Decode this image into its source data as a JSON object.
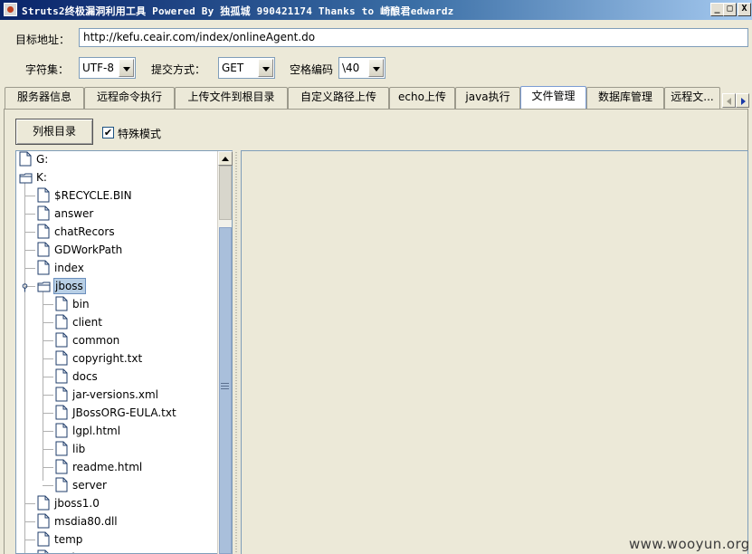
{
  "window": {
    "title": "Struts2终极漏洞利用工具    Powered By 独孤城 990421174 Thanks to 崎酿君edwardz",
    "controls": {
      "minimize": "_",
      "maximize": "□",
      "close": "X"
    }
  },
  "form": {
    "url_label": "目标地址：",
    "url_value": "http://kefu.ceair.com/index/onlineAgent.do",
    "charset_label": "字符集：",
    "charset_value": "UTF-8",
    "method_label": "提交方式：",
    "method_value": "GET",
    "space_label": "空格编码",
    "space_value": "\\40"
  },
  "tabs": [
    {
      "label": "服务器信息",
      "active": false
    },
    {
      "label": "远程命令执行",
      "active": false
    },
    {
      "label": "上传文件到根目录",
      "active": false
    },
    {
      "label": "自定义路径上传",
      "active": false
    },
    {
      "label": "echo上传",
      "active": false
    },
    {
      "label": "java执行",
      "active": false
    },
    {
      "label": "文件管理",
      "active": true
    },
    {
      "label": "数据库管理",
      "active": false
    },
    {
      "label": "远程文...",
      "active": false
    }
  ],
  "file_manager": {
    "list_root_button": "列根目录",
    "special_mode_label": "特殊模式",
    "special_mode_checked": true,
    "tree": [
      {
        "name": "G:",
        "depth": 0,
        "type": "file"
      },
      {
        "name": "K:",
        "depth": 0,
        "type": "folder"
      },
      {
        "name": "$RECYCLE.BIN",
        "depth": 1,
        "type": "file"
      },
      {
        "name": "answer",
        "depth": 1,
        "type": "file"
      },
      {
        "name": "chatRecors",
        "depth": 1,
        "type": "file"
      },
      {
        "name": "GDWorkPath",
        "depth": 1,
        "type": "file"
      },
      {
        "name": "index",
        "depth": 1,
        "type": "file"
      },
      {
        "name": "jboss",
        "depth": 1,
        "type": "folder",
        "selected": true
      },
      {
        "name": "bin",
        "depth": 2,
        "type": "file"
      },
      {
        "name": "client",
        "depth": 2,
        "type": "file"
      },
      {
        "name": "common",
        "depth": 2,
        "type": "file"
      },
      {
        "name": "copyright.txt",
        "depth": 2,
        "type": "file"
      },
      {
        "name": "docs",
        "depth": 2,
        "type": "file"
      },
      {
        "name": "jar-versions.xml",
        "depth": 2,
        "type": "file"
      },
      {
        "name": "JBossORG-EULA.txt",
        "depth": 2,
        "type": "file"
      },
      {
        "name": "lgpl.html",
        "depth": 2,
        "type": "file"
      },
      {
        "name": "lib",
        "depth": 2,
        "type": "file"
      },
      {
        "name": "readme.html",
        "depth": 2,
        "type": "file"
      },
      {
        "name": "server",
        "depth": 2,
        "type": "file"
      },
      {
        "name": "jboss1.0",
        "depth": 1,
        "type": "file"
      },
      {
        "name": "msdia80.dll",
        "depth": 1,
        "type": "file"
      },
      {
        "name": "temp",
        "depth": 1,
        "type": "file"
      },
      {
        "name": "tool",
        "depth": 1,
        "type": "file"
      }
    ]
  },
  "watermark": "www.wooyun.org"
}
